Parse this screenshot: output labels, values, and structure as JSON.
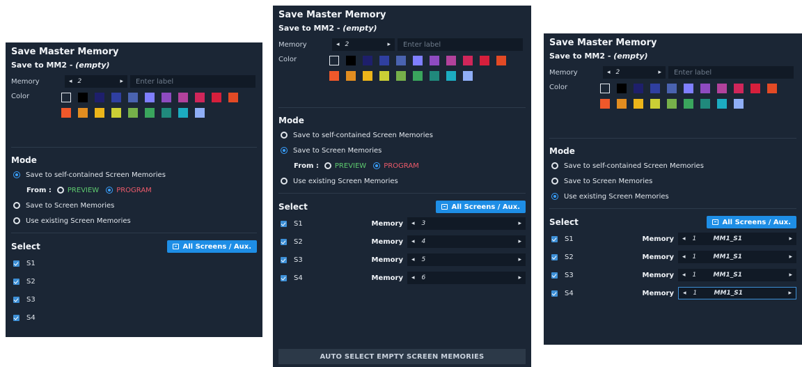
{
  "swatch_colors": [
    "#1b2635",
    "#000000",
    "#1e1f6b",
    "#2f3fa0",
    "#4a63b0",
    "#7f7fff",
    "#8e4bc0",
    "#b2429c",
    "#d0265a",
    "#d61f3c",
    "#e34a25",
    "#f0582a",
    "#e28d20",
    "#ecb51a",
    "#cbcf35",
    "#76b04a",
    "#3aa55d",
    "#20897c",
    "#1cacc1",
    "#8faef6"
  ],
  "panels": [
    {
      "title": "Save Master Memory",
      "save_to": "Save to MM2 - ",
      "save_empty": "(empty)",
      "memory_label": "Memory",
      "memory_value": "2",
      "label_placeholder": "Enter label",
      "color_label": "Color",
      "mode_title": "Mode",
      "opt_self": "Save to self-contained Screen Memories",
      "opt_screen": "Save to Screen Memories",
      "opt_existing": "Use existing Screen Memories",
      "from_label": "From :",
      "preview": "PREVIEW",
      "program": "PROGRAM",
      "select_title": "Select",
      "all_screens": "All Screens / Aux.",
      "screens": [
        "S1",
        "S2",
        "S3",
        "S4"
      ]
    },
    {
      "title": "Save Master Memory",
      "save_to": "Save to MM2 - ",
      "save_empty": "(empty)",
      "memory_label": "Memory",
      "memory_value": "2",
      "label_placeholder": "Enter label",
      "color_label": "Color",
      "mode_title": "Mode",
      "opt_self": "Save to self-contained Screen Memories",
      "opt_screen": "Save to Screen Memories",
      "opt_existing": "Use existing Screen Memories",
      "from_label": "From :",
      "preview": "PREVIEW",
      "program": "PROGRAM",
      "select_title": "Select",
      "all_screens": "All Screens / Aux.",
      "screens": [
        {
          "name": "S1",
          "mem_label": "Memory",
          "value": "3"
        },
        {
          "name": "S2",
          "mem_label": "Memory",
          "value": "4"
        },
        {
          "name": "S3",
          "mem_label": "Memory",
          "value": "5"
        },
        {
          "name": "S4",
          "mem_label": "Memory",
          "value": "6"
        }
      ],
      "auto_select": "AUTO SELECT EMPTY SCREEN MEMORIES"
    },
    {
      "title": "Save Master Memory",
      "save_to": "Save to MM2 - ",
      "save_empty": "(empty)",
      "memory_label": "Memory",
      "memory_value": "2",
      "label_placeholder": "Enter label",
      "color_label": "Color",
      "mode_title": "Mode",
      "opt_self": "Save to self-contained Screen Memories",
      "opt_screen": "Save to Screen Memories",
      "opt_existing": "Use existing Screen Memories",
      "select_title": "Select",
      "all_screens": "All Screens / Aux.",
      "screens": [
        {
          "name": "S1",
          "mem_label": "Memory",
          "value": "1",
          "mm": "MM1_S1"
        },
        {
          "name": "S2",
          "mem_label": "Memory",
          "value": "1",
          "mm": "MM1_S1"
        },
        {
          "name": "S3",
          "mem_label": "Memory",
          "value": "1",
          "mm": "MM1_S1"
        },
        {
          "name": "S4",
          "mem_label": "Memory",
          "value": "1",
          "mm": "MM1_S1"
        }
      ]
    }
  ]
}
